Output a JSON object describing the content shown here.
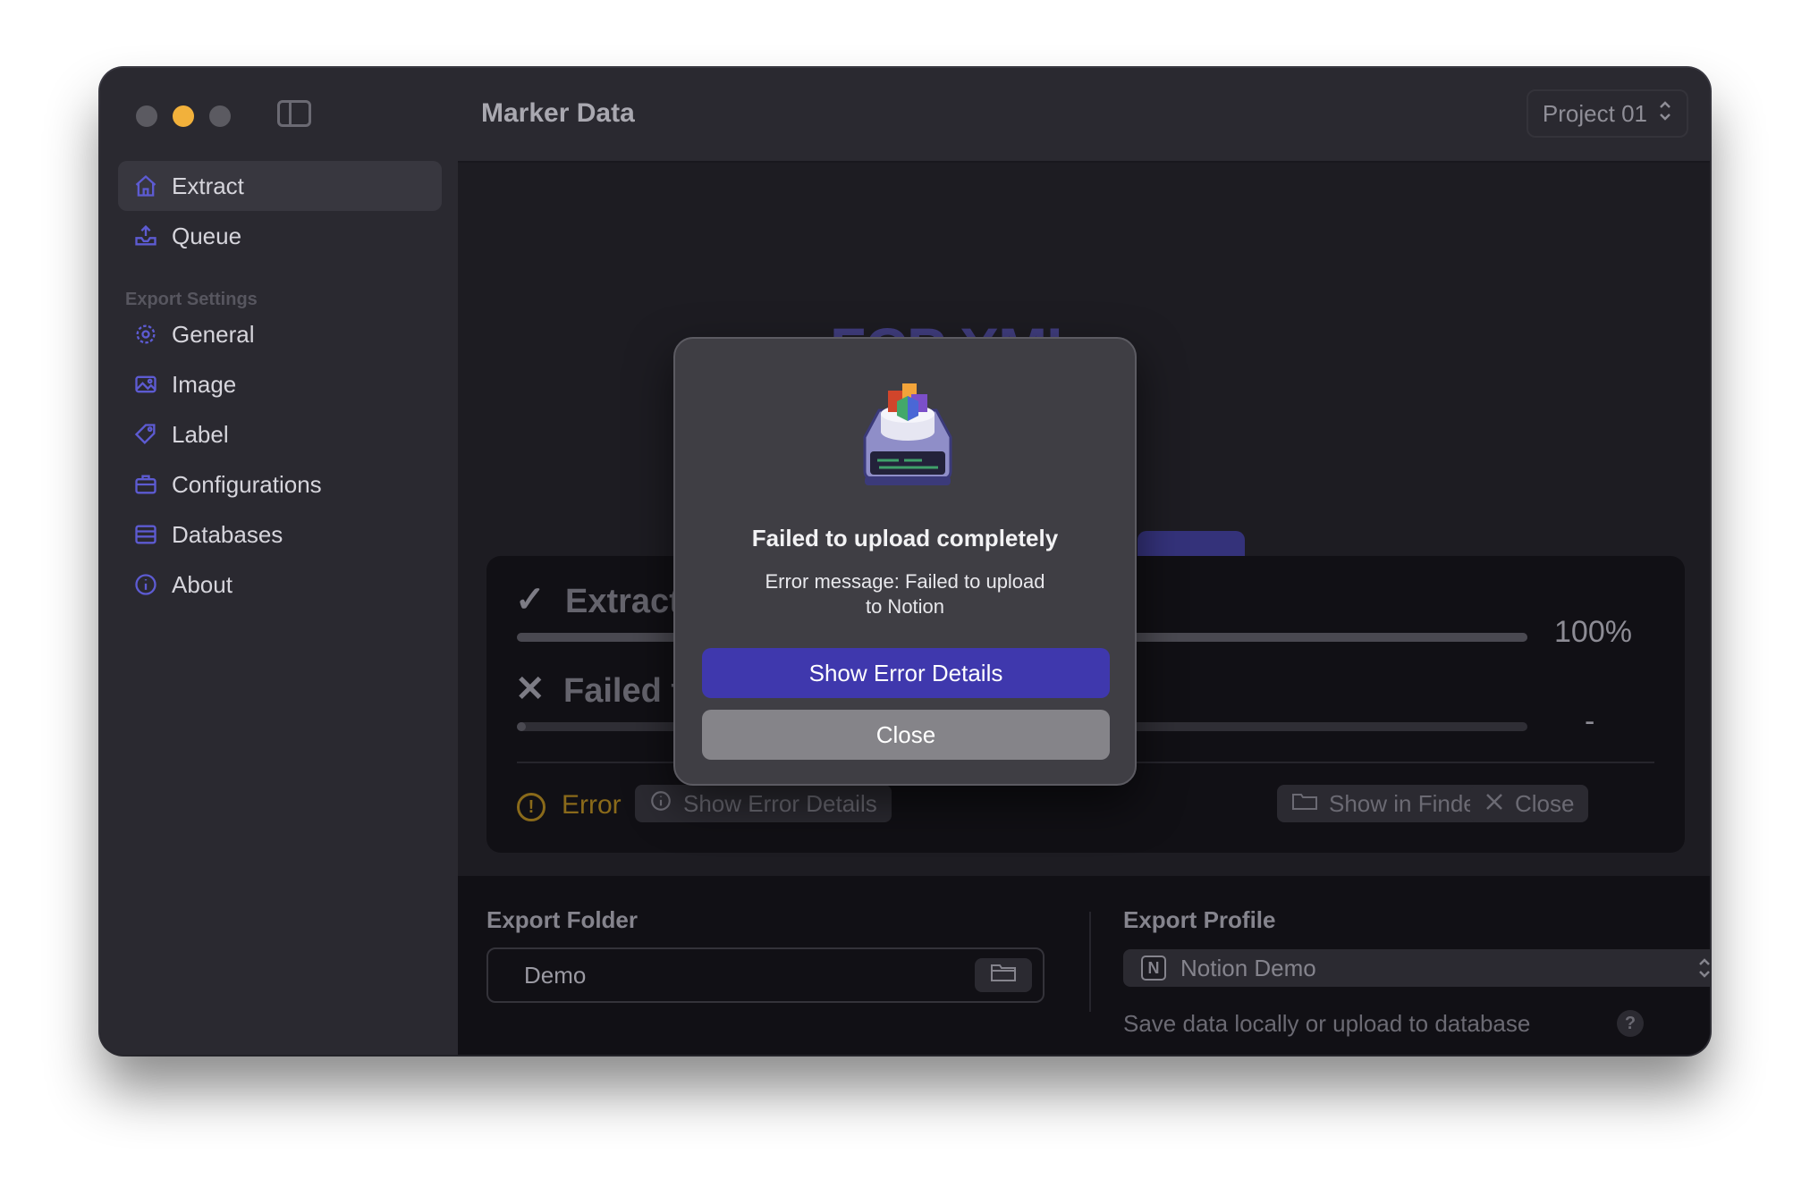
{
  "window": {
    "title": "Marker Data",
    "project_selector": "Project 01"
  },
  "sidebar": {
    "items": [
      {
        "label": "Extract",
        "icon": "house-icon",
        "active": true
      },
      {
        "label": "Queue",
        "icon": "tray-upload-icon",
        "active": false
      }
    ],
    "section_label": "Export Settings",
    "settings_items": [
      {
        "label": "General",
        "icon": "gear-icon"
      },
      {
        "label": "Image",
        "icon": "photo-icon"
      },
      {
        "label": "Label",
        "icon": "tag-icon"
      },
      {
        "label": "Configurations",
        "icon": "briefcase-icon"
      },
      {
        "label": "Databases",
        "icon": "database-icon"
      },
      {
        "label": "About",
        "icon": "info-icon"
      }
    ]
  },
  "main": {
    "headline_partial": "op FCP XML",
    "progress": {
      "row1_label": "Extract",
      "row1_percent": "100%",
      "row1_fill": 1.0,
      "row2_label": "Failed t",
      "row2_percent": "-",
      "row2_fill": 0.0,
      "status_label": "Error",
      "show_error_details": "Show Error Details",
      "show_in_finder": "Show in Finder",
      "close": "Close"
    }
  },
  "footer": {
    "export_folder_label": "Export Folder",
    "export_folder_value": "Demo",
    "export_profile_label": "Export Profile",
    "export_profile_value": "Notion Demo",
    "help_text": "Save data locally or upload to database",
    "help_button": "?"
  },
  "modal": {
    "title": "Failed to upload completely",
    "message_line1": "Error message: Failed to upload",
    "message_line2": "to Notion",
    "primary_button": "Show Error Details",
    "secondary_button": "Close"
  },
  "colors": {
    "accent": "#3f38ad",
    "sidebar_icon": "#5d5bd2",
    "error": "#8a6a1a",
    "traffic_minimize": "#f2b13b"
  }
}
